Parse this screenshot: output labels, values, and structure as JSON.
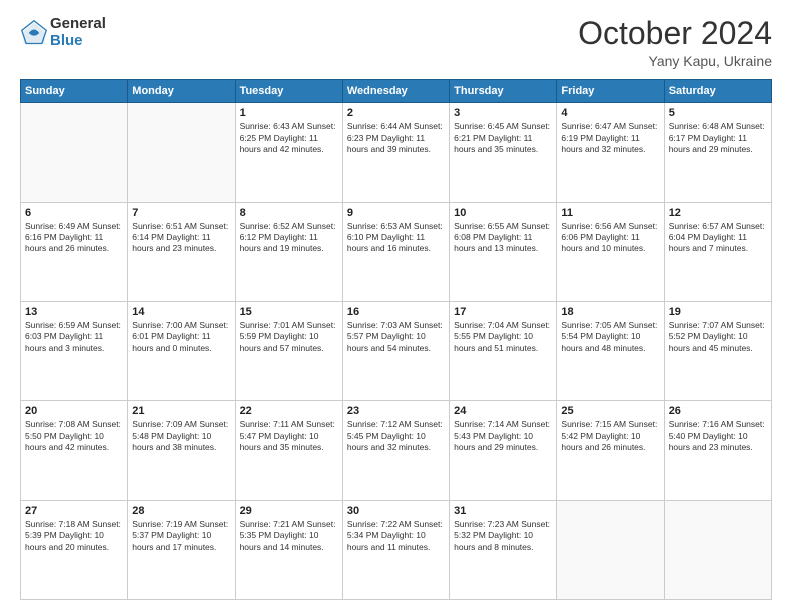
{
  "header": {
    "logo_general": "General",
    "logo_blue": "Blue",
    "title": "October 2024",
    "location": "Yany Kapu, Ukraine"
  },
  "days_of_week": [
    "Sunday",
    "Monday",
    "Tuesday",
    "Wednesday",
    "Thursday",
    "Friday",
    "Saturday"
  ],
  "weeks": [
    [
      {
        "day": "",
        "detail": ""
      },
      {
        "day": "",
        "detail": ""
      },
      {
        "day": "1",
        "detail": "Sunrise: 6:43 AM\nSunset: 6:25 PM\nDaylight: 11 hours and 42 minutes."
      },
      {
        "day": "2",
        "detail": "Sunrise: 6:44 AM\nSunset: 6:23 PM\nDaylight: 11 hours and 39 minutes."
      },
      {
        "day": "3",
        "detail": "Sunrise: 6:45 AM\nSunset: 6:21 PM\nDaylight: 11 hours and 35 minutes."
      },
      {
        "day": "4",
        "detail": "Sunrise: 6:47 AM\nSunset: 6:19 PM\nDaylight: 11 hours and 32 minutes."
      },
      {
        "day": "5",
        "detail": "Sunrise: 6:48 AM\nSunset: 6:17 PM\nDaylight: 11 hours and 29 minutes."
      }
    ],
    [
      {
        "day": "6",
        "detail": "Sunrise: 6:49 AM\nSunset: 6:16 PM\nDaylight: 11 hours and 26 minutes."
      },
      {
        "day": "7",
        "detail": "Sunrise: 6:51 AM\nSunset: 6:14 PM\nDaylight: 11 hours and 23 minutes."
      },
      {
        "day": "8",
        "detail": "Sunrise: 6:52 AM\nSunset: 6:12 PM\nDaylight: 11 hours and 19 minutes."
      },
      {
        "day": "9",
        "detail": "Sunrise: 6:53 AM\nSunset: 6:10 PM\nDaylight: 11 hours and 16 minutes."
      },
      {
        "day": "10",
        "detail": "Sunrise: 6:55 AM\nSunset: 6:08 PM\nDaylight: 11 hours and 13 minutes."
      },
      {
        "day": "11",
        "detail": "Sunrise: 6:56 AM\nSunset: 6:06 PM\nDaylight: 11 hours and 10 minutes."
      },
      {
        "day": "12",
        "detail": "Sunrise: 6:57 AM\nSunset: 6:04 PM\nDaylight: 11 hours and 7 minutes."
      }
    ],
    [
      {
        "day": "13",
        "detail": "Sunrise: 6:59 AM\nSunset: 6:03 PM\nDaylight: 11 hours and 3 minutes."
      },
      {
        "day": "14",
        "detail": "Sunrise: 7:00 AM\nSunset: 6:01 PM\nDaylight: 11 hours and 0 minutes."
      },
      {
        "day": "15",
        "detail": "Sunrise: 7:01 AM\nSunset: 5:59 PM\nDaylight: 10 hours and 57 minutes."
      },
      {
        "day": "16",
        "detail": "Sunrise: 7:03 AM\nSunset: 5:57 PM\nDaylight: 10 hours and 54 minutes."
      },
      {
        "day": "17",
        "detail": "Sunrise: 7:04 AM\nSunset: 5:55 PM\nDaylight: 10 hours and 51 minutes."
      },
      {
        "day": "18",
        "detail": "Sunrise: 7:05 AM\nSunset: 5:54 PM\nDaylight: 10 hours and 48 minutes."
      },
      {
        "day": "19",
        "detail": "Sunrise: 7:07 AM\nSunset: 5:52 PM\nDaylight: 10 hours and 45 minutes."
      }
    ],
    [
      {
        "day": "20",
        "detail": "Sunrise: 7:08 AM\nSunset: 5:50 PM\nDaylight: 10 hours and 42 minutes."
      },
      {
        "day": "21",
        "detail": "Sunrise: 7:09 AM\nSunset: 5:48 PM\nDaylight: 10 hours and 38 minutes."
      },
      {
        "day": "22",
        "detail": "Sunrise: 7:11 AM\nSunset: 5:47 PM\nDaylight: 10 hours and 35 minutes."
      },
      {
        "day": "23",
        "detail": "Sunrise: 7:12 AM\nSunset: 5:45 PM\nDaylight: 10 hours and 32 minutes."
      },
      {
        "day": "24",
        "detail": "Sunrise: 7:14 AM\nSunset: 5:43 PM\nDaylight: 10 hours and 29 minutes."
      },
      {
        "day": "25",
        "detail": "Sunrise: 7:15 AM\nSunset: 5:42 PM\nDaylight: 10 hours and 26 minutes."
      },
      {
        "day": "26",
        "detail": "Sunrise: 7:16 AM\nSunset: 5:40 PM\nDaylight: 10 hours and 23 minutes."
      }
    ],
    [
      {
        "day": "27",
        "detail": "Sunrise: 7:18 AM\nSunset: 5:39 PM\nDaylight: 10 hours and 20 minutes."
      },
      {
        "day": "28",
        "detail": "Sunrise: 7:19 AM\nSunset: 5:37 PM\nDaylight: 10 hours and 17 minutes."
      },
      {
        "day": "29",
        "detail": "Sunrise: 7:21 AM\nSunset: 5:35 PM\nDaylight: 10 hours and 14 minutes."
      },
      {
        "day": "30",
        "detail": "Sunrise: 7:22 AM\nSunset: 5:34 PM\nDaylight: 10 hours and 11 minutes."
      },
      {
        "day": "31",
        "detail": "Sunrise: 7:23 AM\nSunset: 5:32 PM\nDaylight: 10 hours and 8 minutes."
      },
      {
        "day": "",
        "detail": ""
      },
      {
        "day": "",
        "detail": ""
      }
    ]
  ]
}
